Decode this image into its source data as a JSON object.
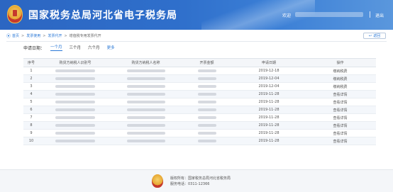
{
  "header": {
    "title": "国家税务总局河北省电子税务局",
    "welcome": "欢迎",
    "logout": "退出"
  },
  "breadcrumb": [
    "首页",
    "发票使用",
    "发票代开",
    "增值税专用发票代开"
  ],
  "back_label": "返回",
  "filter": {
    "label": "申请日期：",
    "options": [
      "一个月",
      "三个月",
      "六个月",
      "更多"
    ],
    "active": 0
  },
  "table": {
    "headers": [
      "序号",
      "购货方纳税人识别号",
      "购货方纳税人名称",
      "开票金额",
      "申请日期",
      "操作"
    ],
    "rows": [
      {
        "no": "1",
        "date": "2019-12-18",
        "action": "缴纳税费"
      },
      {
        "no": "2",
        "date": "2019-12-04",
        "action": "缴纳税费"
      },
      {
        "no": "3",
        "date": "2019-12-04",
        "action": "缴纳税费"
      },
      {
        "no": "4",
        "date": "2019-11-28",
        "action": "查看详情"
      },
      {
        "no": "5",
        "date": "2019-11-28",
        "action": "查看详情"
      },
      {
        "no": "6",
        "date": "2019-11-28",
        "action": "查看详情"
      },
      {
        "no": "7",
        "date": "2019-11-28",
        "action": "查看详情"
      },
      {
        "no": "8",
        "date": "2019-11-28",
        "action": "查看详情"
      },
      {
        "no": "9",
        "date": "2019-11-28",
        "action": "查看详情"
      },
      {
        "no": "10",
        "date": "2019-11-28",
        "action": "查看详情"
      }
    ]
  },
  "footer": {
    "copyright": "版权所有：国家税务总局河北省税务局",
    "hotline": "服务电话：0311-12366"
  },
  "colors": {
    "header_blue": "#2f6fcb",
    "link_blue": "#2a78d6"
  }
}
